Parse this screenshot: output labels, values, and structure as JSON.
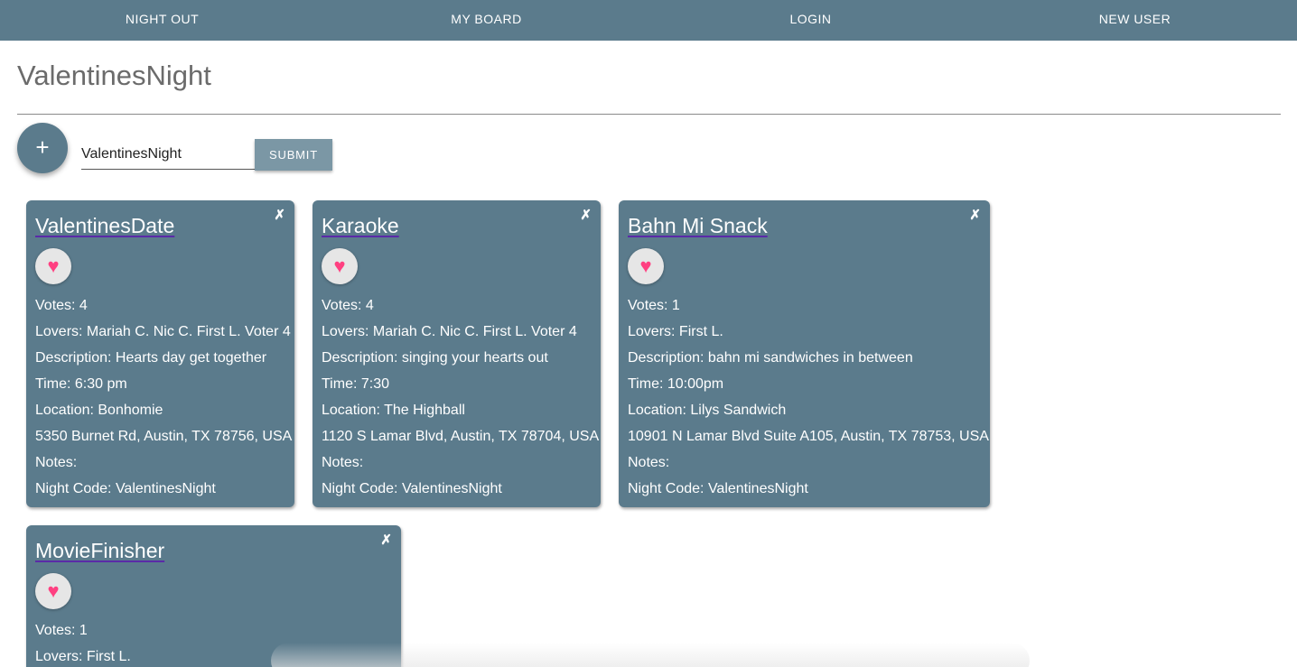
{
  "nav": {
    "items": [
      {
        "label": "NIGHT OUT"
      },
      {
        "label": "MY BOARD"
      },
      {
        "label": "LOGIN"
      },
      {
        "label": "NEW USER"
      }
    ]
  },
  "page": {
    "title": "ValentinesNight"
  },
  "form": {
    "add_icon": "+",
    "night_code_value": "ValentinesNight",
    "submit_label": "SUBMIT"
  },
  "icons": {
    "heart": "heart-icon",
    "close": "close-icon",
    "add": "add-icon",
    "heart_color": "#ff4081",
    "card_color": "#5b7b8c"
  },
  "cards": [
    {
      "title": "ValentinesDate",
      "close": "✗",
      "heart": "♥",
      "fields": [
        "Votes: 4",
        "Lovers: Mariah C. Nic C. First L. Voter 4",
        "Description: Hearts day get together",
        "Time: 6:30 pm",
        "Location: Bonhomie",
        "5350 Burnet Rd, Austin, TX 78756, USA",
        "Notes:",
        "Night Code: ValentinesNight"
      ]
    },
    {
      "title": "Karaoke",
      "close": "✗",
      "heart": "♥",
      "fields": [
        "Votes: 4",
        "Lovers: Mariah C. Nic C. First L. Voter 4",
        "Description: singing your hearts out",
        "Time: 7:30",
        "Location: The Highball",
        "1120 S Lamar Blvd, Austin, TX 78704, USA",
        "Notes:",
        "Night Code: ValentinesNight"
      ]
    },
    {
      "title": "Bahn Mi Snack",
      "close": "✗",
      "heart": "♥",
      "fields": [
        "Votes: 1",
        "Lovers: First L.",
        "Description: bahn mi sandwiches in between",
        "Time: 10:00pm",
        "Location: Lilys Sandwich",
        "10901 N Lamar Blvd Suite A105, Austin, TX 78753, USA",
        "Notes:",
        "Night Code: ValentinesNight"
      ]
    },
    {
      "title": "MovieFinisher",
      "close": "✗",
      "heart": "♥",
      "fields": [
        "Votes: 1",
        "Lovers: First L."
      ]
    }
  ]
}
